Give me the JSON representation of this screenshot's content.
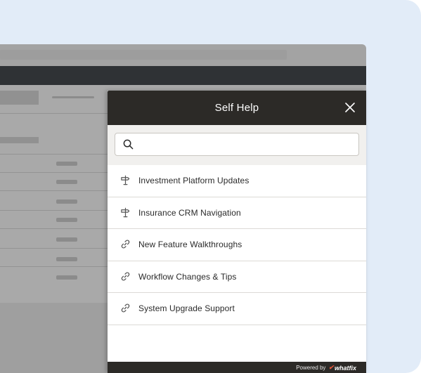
{
  "panel": {
    "title": "Self Help",
    "search": {
      "placeholder": ""
    },
    "items": [
      {
        "label": "Investment Platform Updates",
        "icon": "signpost-icon"
      },
      {
        "label": "Insurance CRM Navigation",
        "icon": "signpost-icon"
      },
      {
        "label": "New Feature Walkthroughs",
        "icon": "link-icon"
      },
      {
        "label": "Workflow Changes & Tips",
        "icon": "link-icon"
      },
      {
        "label": "System Upgrade Support",
        "icon": "link-icon"
      }
    ],
    "footer": {
      "powered_by": "Powered by",
      "brand": "whatfix"
    }
  },
  "colors": {
    "header_bg": "#2c2a27",
    "page_bg": "#e2ecf8",
    "brand_accent": "#e8573a"
  }
}
